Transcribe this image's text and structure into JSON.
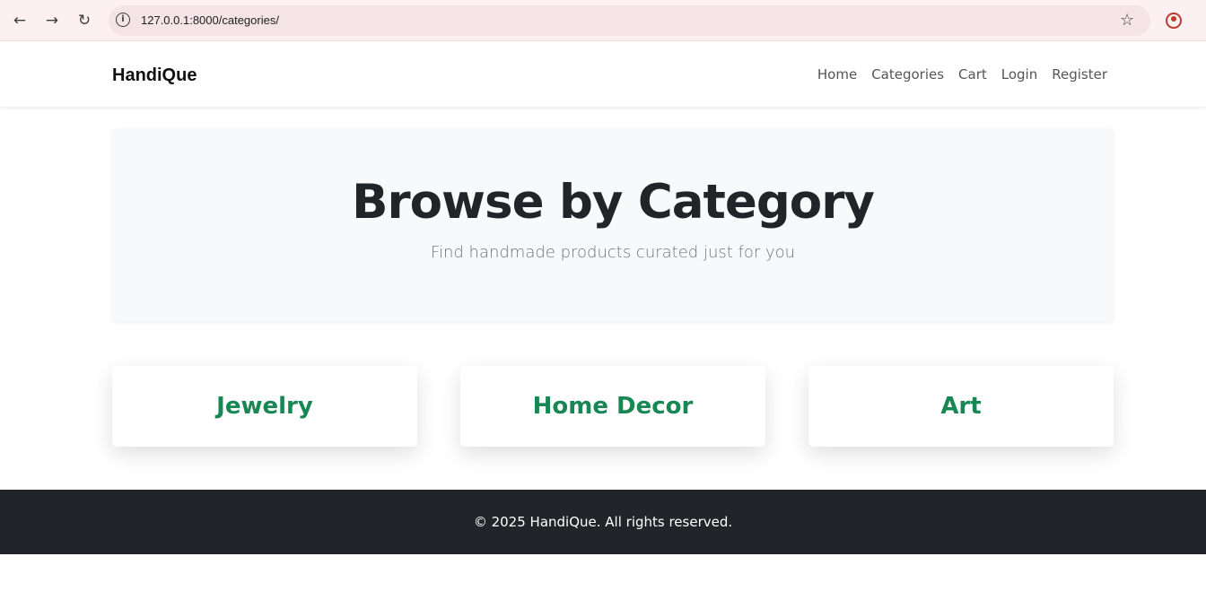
{
  "browser": {
    "url": "127.0.0.1:8000/categories/",
    "back_icon": "←",
    "forward_icon": "→",
    "reload_icon": "↻",
    "info_icon": "i",
    "star_icon": "☆",
    "menu_icon": "⋮"
  },
  "navbar": {
    "brand": "HandiQue",
    "links": [
      "Home",
      "Categories",
      "Cart",
      "Login",
      "Register"
    ]
  },
  "hero": {
    "title": "Browse by Category",
    "subtitle": "Find handmade products curated just for you"
  },
  "categories": [
    "Jewelry",
    "Home Decor",
    "Art"
  ],
  "footer": {
    "text": "© 2025 HandiQue. All rights reserved."
  },
  "colors": {
    "accent": "#198754",
    "footer_bg": "#212529",
    "hero_bg": "#f8f9fa"
  }
}
